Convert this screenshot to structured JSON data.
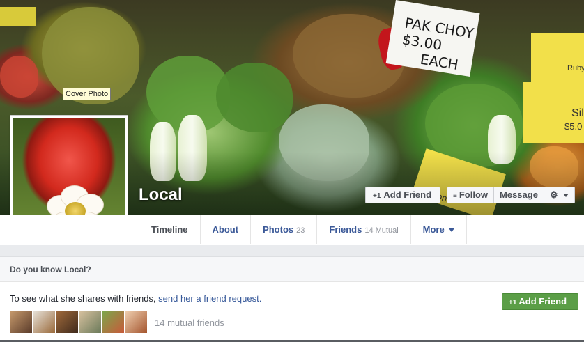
{
  "cover": {
    "tooltip": "Cover Photo",
    "sign_pak_choy": [
      "PAK CHOY",
      "$3.00",
      "EACH"
    ],
    "sign_ruby": "Ruby",
    "sign_silver": "Sil",
    "sign_price": "$5.0",
    "sign_bottom": "ssions"
  },
  "profile": {
    "name": "Local",
    "buttons": {
      "add_friend": "Add Friend",
      "follow": "Follow",
      "message": "Message",
      "settings_icon": "gear-icon"
    }
  },
  "tabs": [
    {
      "label": "Timeline",
      "count": ""
    },
    {
      "label": "About",
      "count": ""
    },
    {
      "label": "Photos",
      "count": "23"
    },
    {
      "label": "Friends",
      "count": "14 Mutual"
    },
    {
      "label": "More",
      "count": ""
    }
  ],
  "know": {
    "heading": "Do you know Local?",
    "text_prefix": "To see what she shares with friends, ",
    "link": "send her a friend request.",
    "add_friend": "Add Friend",
    "mutual": "14 mutual friends"
  },
  "colors": {
    "link_blue": "#3b5998",
    "green_button": "#5b9e47"
  }
}
